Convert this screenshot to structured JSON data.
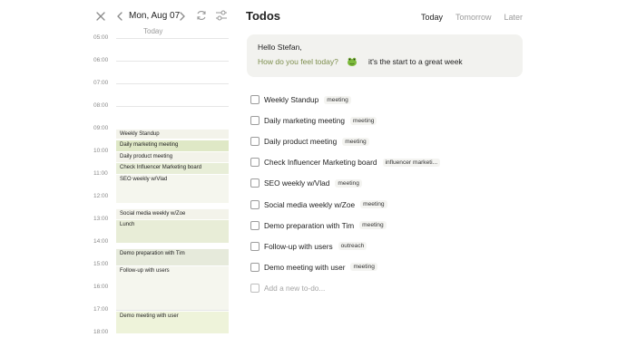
{
  "calendar": {
    "date": "Mon, Aug 07",
    "today_label": "Today",
    "icons": {
      "close": "close-icon",
      "prev": "chevron-left-icon",
      "next": "chevron-right-icon",
      "refresh": "refresh-icon",
      "settings": "sliders-icon"
    },
    "hours": [
      "05:00",
      "06:00",
      "07:00",
      "08:00",
      "09:00",
      "10:00",
      "11:00",
      "12:00",
      "13:00",
      "14:00",
      "15:00",
      "16:00",
      "17:00",
      "18:00"
    ],
    "events": [
      {
        "title": "Weekly Standup",
        "color": "#f3f3ea"
      },
      {
        "title": "Daily marketing meeting",
        "color": "#dfe8c6"
      },
      {
        "title": "Daily product meeting",
        "color": "#f3f3ea"
      },
      {
        "title": "Check Influencer Marketing board",
        "color": "#e8eed8"
      },
      {
        "title": "SEO weekly w/Vlad",
        "color": "#f5f6ee"
      },
      {
        "title": "Social media weekly w/Zoe",
        "color": "#f3f3ea"
      },
      {
        "title": "Lunch",
        "color": "#e8edd7"
      },
      {
        "title": "Demo preparation with Tim",
        "color": "#e6eadb"
      },
      {
        "title": "Follow-up with users",
        "color": "#f5f6ee"
      },
      {
        "title": "Demo meeting with user",
        "color": "#eef3da"
      }
    ]
  },
  "todos": {
    "title": "Todos",
    "tabs": [
      {
        "label": "Today",
        "active": true
      },
      {
        "label": "Tomorrow",
        "active": false
      },
      {
        "label": "Later",
        "active": false
      }
    ],
    "greeting": {
      "hello": "Hello Stefan,",
      "question": "How do you feel today?",
      "emoji": "frog-emoji-icon",
      "answer": "it's the start to a great week"
    },
    "items": [
      {
        "text": "Weekly Standup",
        "tag": "meeting"
      },
      {
        "text": "Daily marketing meeting",
        "tag": "meeting"
      },
      {
        "text": "Daily product meeting",
        "tag": "meeting"
      },
      {
        "text": "Check Influencer Marketing board",
        "tag": "influencer marketi..."
      },
      {
        "text": "SEO weekly w/Vlad",
        "tag": "meeting"
      },
      {
        "text": "Social media weekly w/Zoe",
        "tag": "meeting"
      },
      {
        "text": "Demo preparation with Tim",
        "tag": "meeting"
      },
      {
        "text": "Follow-up with users",
        "tag": "outreach"
      },
      {
        "text": "Demo meeting with user",
        "tag": "meeting"
      }
    ],
    "add_placeholder": "Add a new to-do..."
  },
  "colors": {
    "accent_green": "#7e8f4f",
    "greeting_bg": "#f2f2ef"
  }
}
